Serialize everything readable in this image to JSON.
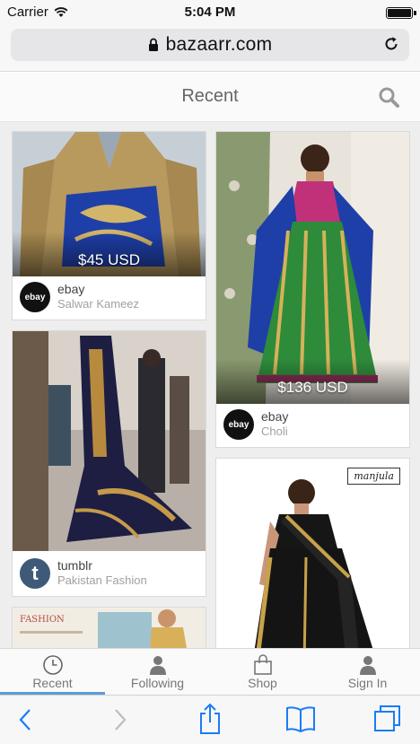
{
  "status_bar": {
    "carrier": "Carrier",
    "time": "5:04 PM"
  },
  "browser": {
    "url": "bazaarr.com"
  },
  "header": {
    "title": "Recent"
  },
  "feed": {
    "cards": [
      {
        "price": "$45 USD",
        "source": "ebay",
        "category": "Salwar Kameez",
        "avatar": "ebay"
      },
      {
        "price": "$136 USD",
        "source": "ebay",
        "category": "Choli",
        "avatar": "ebay"
      },
      {
        "price": "",
        "source": "tumblr",
        "category": "Pakistan Fashion",
        "avatar": "t"
      },
      {
        "brand": "manjula"
      },
      {
        "tag": "FASHION"
      }
    ]
  },
  "tabs": [
    {
      "label": "Recent",
      "icon": "clock-icon",
      "active": true
    },
    {
      "label": "Following",
      "icon": "person-icon",
      "active": false
    },
    {
      "label": "Shop",
      "icon": "bag-icon",
      "active": false
    },
    {
      "label": "Sign In",
      "icon": "person-icon",
      "active": false
    }
  ],
  "colors": {
    "accent": "#5a9bd5",
    "ios_blue": "#1a7cf5",
    "dress_green": "#2e8b3a",
    "dress_blue": "#1f3fa8"
  }
}
